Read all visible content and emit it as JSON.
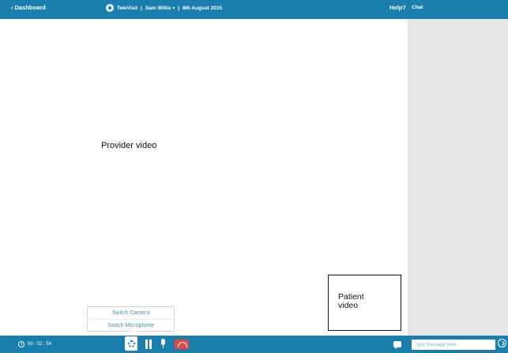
{
  "header": {
    "back_label": "‹ Dashboard",
    "app_name": "TeleVisit",
    "user": "Sam Willis",
    "date": "8th August 2015",
    "help_label": "Help?"
  },
  "chat": {
    "title": "Chat",
    "input_placeholder": "Type message here"
  },
  "video": {
    "provider_label": "Provider video",
    "patient_label": "Patient video"
  },
  "settings_menu": {
    "items": [
      "Switch Camera",
      "Switch Microphone"
    ]
  },
  "call": {
    "timer": "00 : 02 : 54"
  },
  "colors": {
    "bar": "#1a7fae",
    "panel": "#e6e6e6",
    "hangup": "#e7463b",
    "menu_text": "#4a8fb7"
  }
}
